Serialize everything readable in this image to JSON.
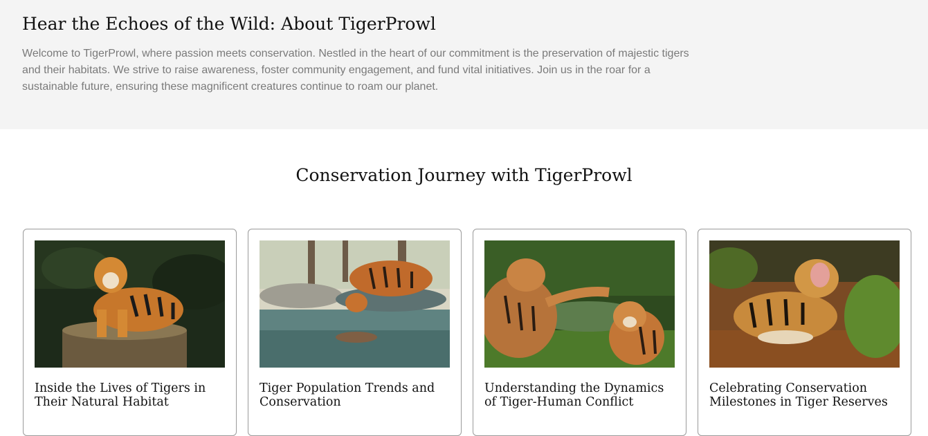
{
  "about": {
    "title": "Hear the Echoes of the Wild: About TigerProwl",
    "description": "Welcome to TigerProwl, where passion meets conservation. Nestled in the heart of our commitment is the preservation of majestic tigers and their habitats. We strive to raise awareness, foster community engagement, and fund vital initiatives. Join us in the roar for a sustainable future, ensuring these magnificent creatures continue to roam our planet."
  },
  "journey": {
    "title": "Conservation Journey with TigerProwl",
    "cards": [
      {
        "title": "Inside the Lives of Tigers in Their Natural Habitat"
      },
      {
        "title": "Tiger Population Trends and Conservation"
      },
      {
        "title": "Understanding the Dynamics of Tiger-Human Conflict"
      },
      {
        "title": "Celebrating Conservation Milestones in Tiger Reserves"
      }
    ]
  }
}
